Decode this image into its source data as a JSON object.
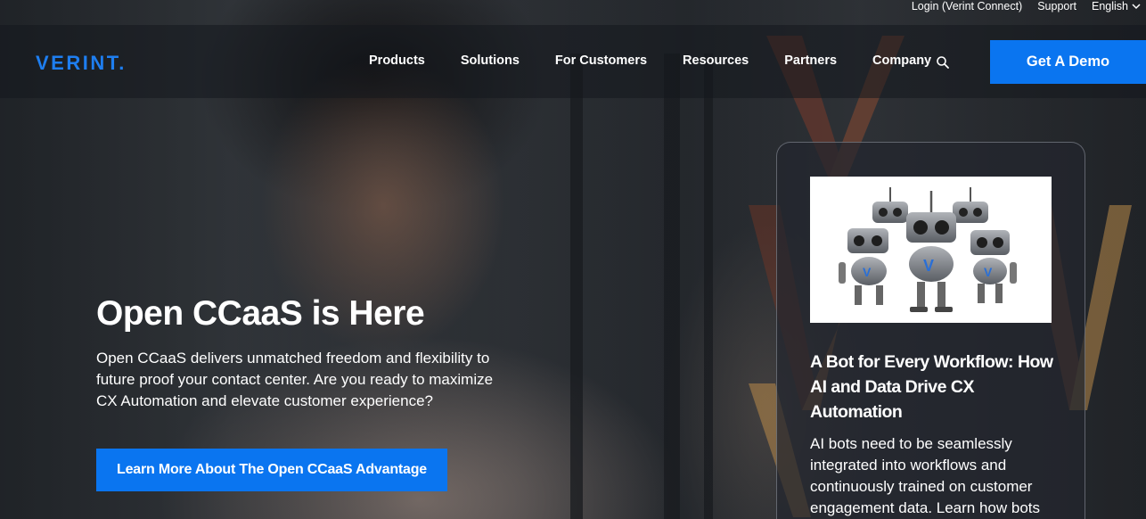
{
  "utility_bar": {
    "login": "Login (Verint Connect)",
    "support": "Support",
    "language": "English"
  },
  "header": {
    "logo": "VERINT.",
    "nav": [
      "Products",
      "Solutions",
      "For Customers",
      "Resources",
      "Partners",
      "Company"
    ],
    "demo_button": "Get A Demo"
  },
  "hero": {
    "title": "Open CCaaS is Here",
    "description": "Open CCaaS delivers unmatched freedom and flexibility to future proof your contact center. Are you ready to maximize CX Automation and elevate customer experience?",
    "cta": "Learn More About The Open CCaaS Advantage"
  },
  "card": {
    "title": "A Bot for Every Workflow: How AI and Data Drive CX Automation",
    "description": "AI bots need to be seamlessly integrated into workflows and continuously trained on customer engagement data. Learn how bots"
  },
  "colors": {
    "brand_blue": "#0a75f0",
    "logo_blue": "#1e7ef0"
  },
  "icons": {
    "search": "search-icon",
    "language_chevron": "chevron-down-icon"
  }
}
